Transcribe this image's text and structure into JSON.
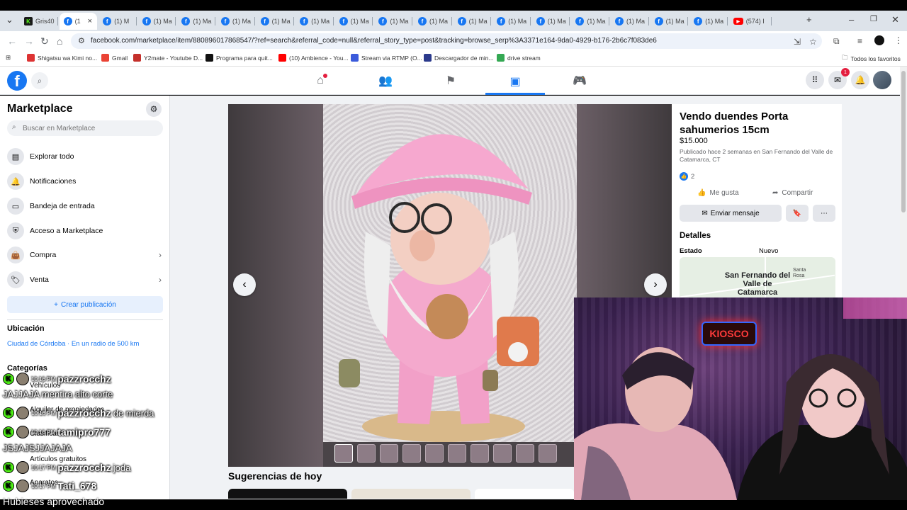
{
  "browser": {
    "tabs": [
      {
        "label": "Gris40",
        "icon": "kick-icon"
      },
      {
        "label": "(1",
        "icon": "facebook-icon",
        "active": true
      },
      {
        "label": "(1) M",
        "icon": "facebook-icon"
      },
      {
        "label": "(1) Ma",
        "icon": "facebook-icon"
      },
      {
        "label": "(1) Ma",
        "icon": "facebook-icon"
      },
      {
        "label": "(1) Ma",
        "icon": "facebook-icon"
      },
      {
        "label": "(1) Ma",
        "icon": "facebook-icon"
      },
      {
        "label": "(1) Ma",
        "icon": "facebook-icon"
      },
      {
        "label": "(1) Ma",
        "icon": "facebook-icon"
      },
      {
        "label": "(1) Ma",
        "icon": "facebook-icon"
      },
      {
        "label": "(1) Ma",
        "icon": "facebook-icon"
      },
      {
        "label": "(1) Ma",
        "icon": "facebook-icon"
      },
      {
        "label": "(1) Ma",
        "icon": "facebook-icon"
      },
      {
        "label": "(1) Ma",
        "icon": "facebook-icon"
      },
      {
        "label": "(1) Ma",
        "icon": "facebook-icon"
      },
      {
        "label": "(1) Ma",
        "icon": "facebook-icon"
      },
      {
        "label": "(1) Ma",
        "icon": "facebook-icon"
      },
      {
        "label": "(1) Ma",
        "icon": "facebook-icon"
      },
      {
        "label": "(574) I",
        "icon": "youtube-icon"
      }
    ],
    "url": "facebook.com/marketplace/item/880896017868547/?ref=search&referral_code=null&referral_story_type=post&tracking=browse_serp%3A3371e164-9da0-4929-b176-2b6c7f083de6",
    "bookmarks": [
      {
        "label": "Shigatsu wa Kimi no...",
        "color": "#d33"
      },
      {
        "label": "Gmail",
        "color": "#ea4335"
      },
      {
        "label": "Y2mate - Youtube D...",
        "color": "#c4302b"
      },
      {
        "label": "Programa para quit...",
        "color": "#111"
      },
      {
        "label": "(10) Ambience - You...",
        "color": "#ff0000"
      },
      {
        "label": "Stream via RTMP (O...",
        "color": "#3b5bdb"
      },
      {
        "label": "Descargador de min...",
        "color": "#2b3a8c"
      },
      {
        "label": "drive stream",
        "color": "#34a853"
      }
    ],
    "all_bookmarks": "Todos los favoritos"
  },
  "fb": {
    "logo": "f",
    "messenger_badge": "1"
  },
  "sidebar": {
    "title": "Marketplace",
    "search_placeholder": "Buscar en Marketplace",
    "items": [
      {
        "label": "Explorar todo",
        "icon": "storefront-icon"
      },
      {
        "label": "Notificaciones",
        "icon": "bell-icon"
      },
      {
        "label": "Bandeja de entrada",
        "icon": "inbox-icon"
      },
      {
        "label": "Acceso a Marketplace",
        "icon": "shield-icon"
      },
      {
        "label": "Compra",
        "icon": "shopping-bag-icon"
      },
      {
        "label": "Venta",
        "icon": "tag-icon"
      }
    ],
    "create_label": "Crear publicación",
    "location_heading": "Ubicación",
    "location_value": "Ciudad de Córdoba · En un radio de 500 km",
    "categories_heading": "Categorías"
  },
  "listing": {
    "title": "Vendo duendes Porta sahumerios 15cm",
    "price": "$15.000",
    "published": "Publicado hace 2 semanas en San Fernando del Valle de Catamarca, CT",
    "likes": "2",
    "like_label": "Me gusta",
    "share_label": "Compartir",
    "send_label": "Enviar mensaje",
    "details_heading": "Detalles",
    "state_label": "Estado",
    "state_value": "Nuevo",
    "map_city": "San Fernando del Valle de Catamarca",
    "map_santa": "Santa Rosa",
    "thumb_count": 10
  },
  "suggestions_heading": "Sugerencias de hoy",
  "stream": {
    "sign": "KIOSCO",
    "chat": [
      {
        "time": "10:16 PM",
        "user": "pazzrocchz",
        "text": ""
      },
      {
        "text": "JAJJAJA mentira alto corte"
      },
      {
        "time": "10:16 PM",
        "user": "pazzrocchz",
        "text": "de mierda"
      },
      {
        "time": "10:16 PM",
        "user": "tamipro777",
        "text": ""
      },
      {
        "text": "JSJAJSJJAJAJA"
      },
      {
        "time": "10:17 PM",
        "user": "pazzrocchz",
        "text": "joda"
      },
      {
        "time": "10:17 PM",
        "user": "Tati_678",
        "text": ""
      }
    ],
    "caption": "Hubieses aprovechado"
  },
  "hidden_sidebar_fragments": [
    "Vehículos",
    "Alquiler de propiedades",
    "Clasificados",
    "Artículos gratuitos",
    "Aparatos"
  ]
}
